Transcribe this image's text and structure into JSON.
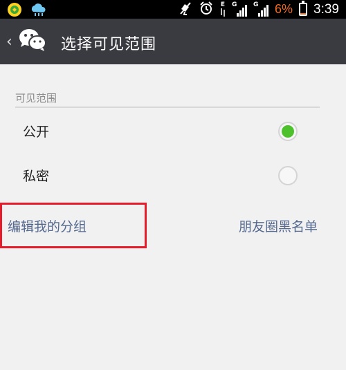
{
  "status_bar": {
    "time": "3:39",
    "battery_percent": "6%",
    "battery_color": "#f26a22",
    "network_labels": [
      "E",
      "G",
      "G"
    ],
    "icons": [
      "app-notification-icon",
      "weather-cloud-icon",
      "muted-icon",
      "alarm-icon",
      "data-arrows-icon",
      "signal-icon",
      "signal-icon",
      "battery-icon"
    ]
  },
  "header": {
    "back_icon": "chevron-left-icon",
    "app_icon": "wechat-icon",
    "title": "选择可见范围"
  },
  "section": {
    "label": "可见范围"
  },
  "options": [
    {
      "label": "公开",
      "selected": true
    },
    {
      "label": "私密",
      "selected": false
    }
  ],
  "links": {
    "edit_groups": "编辑我的分组",
    "blacklist": "朋友圈黑名单"
  },
  "colors": {
    "title_bar": "#3a3b40",
    "accent_green": "#4cc12c",
    "link": "#55698e",
    "highlight": "#e61c2a"
  }
}
